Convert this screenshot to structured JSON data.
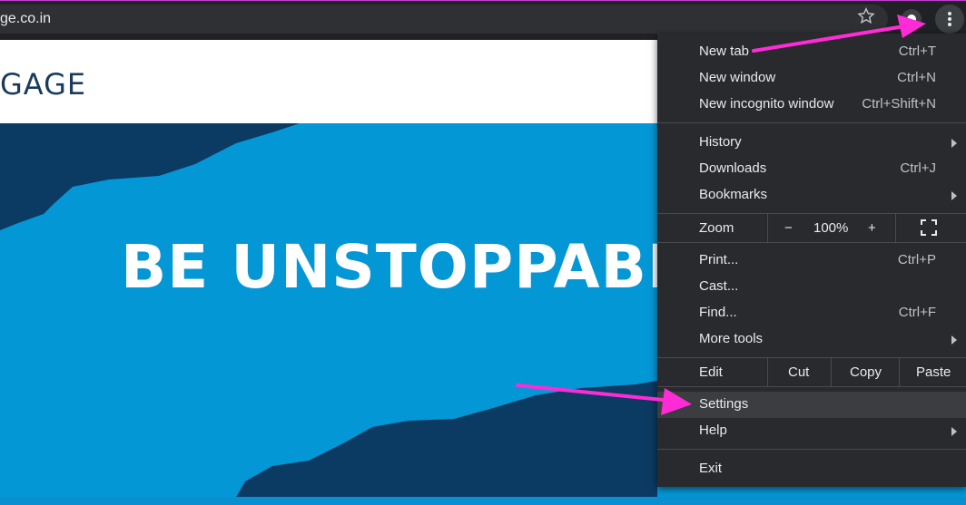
{
  "browser": {
    "url": "ge.co.in",
    "icons": {
      "star": "star-icon",
      "profile": "profile-icon",
      "menu": "more-vertical-icon"
    }
  },
  "page": {
    "site_logo": "GAGE",
    "hero_text": "BE UNSTOPPABLE"
  },
  "menu": {
    "new_tab": {
      "label": "New tab",
      "shortcut": "Ctrl+T"
    },
    "new_window": {
      "label": "New window",
      "shortcut": "Ctrl+N"
    },
    "new_incognito": {
      "label": "New incognito window",
      "shortcut": "Ctrl+Shift+N"
    },
    "history": {
      "label": "History"
    },
    "downloads": {
      "label": "Downloads",
      "shortcut": "Ctrl+J"
    },
    "bookmarks": {
      "label": "Bookmarks"
    },
    "zoom": {
      "label": "Zoom",
      "minus": "−",
      "value": "100%",
      "plus": "+"
    },
    "print": {
      "label": "Print...",
      "shortcut": "Ctrl+P"
    },
    "cast": {
      "label": "Cast..."
    },
    "find": {
      "label": "Find...",
      "shortcut": "Ctrl+F"
    },
    "more_tools": {
      "label": "More tools"
    },
    "edit": {
      "label": "Edit",
      "cut": "Cut",
      "copy": "Copy",
      "paste": "Paste"
    },
    "settings": {
      "label": "Settings"
    },
    "help": {
      "label": "Help"
    },
    "exit": {
      "label": "Exit"
    }
  },
  "colors": {
    "menu_bg": "#292a2d",
    "hero_blue": "#0497d6",
    "hero_dark": "#0b3a63",
    "annotation_arrow": "#ff2bd6"
  }
}
